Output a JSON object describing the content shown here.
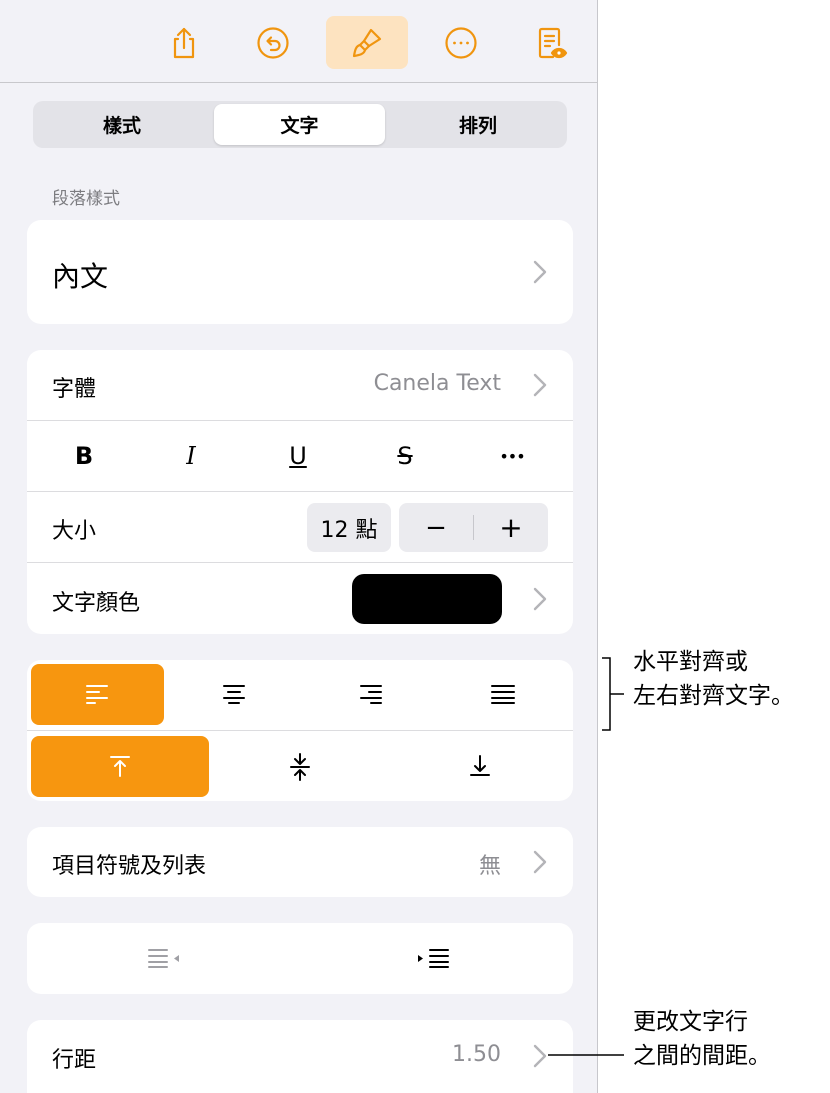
{
  "tabs": {
    "style": "樣式",
    "text": "文字",
    "arrange": "排列"
  },
  "paragraph_style": {
    "section_label": "段落樣式",
    "value": "內文"
  },
  "font": {
    "label": "字體",
    "value": "Canela Text"
  },
  "style_buttons": {
    "bold": "B",
    "italic": "I",
    "underline": "U",
    "strike": "S",
    "more": "•••"
  },
  "size": {
    "label": "大小",
    "value": "12 點",
    "minus": "−",
    "plus": "+"
  },
  "text_color": {
    "label": "文字顏色",
    "swatch": "#000000"
  },
  "bullets": {
    "label": "項目符號及列表",
    "value": "無"
  },
  "line_spacing": {
    "label": "行距",
    "value": "1.50"
  },
  "callouts": {
    "alignment_line1": "水平對齊或",
    "alignment_line2": "左右對齊文字。",
    "spacing_line1": "更改文字行",
    "spacing_line2": "之間的間距。"
  },
  "colors": {
    "accent": "#f7960f",
    "toolbar_icon": "#f0950f",
    "active_tool_bg": "#fde3c0"
  }
}
